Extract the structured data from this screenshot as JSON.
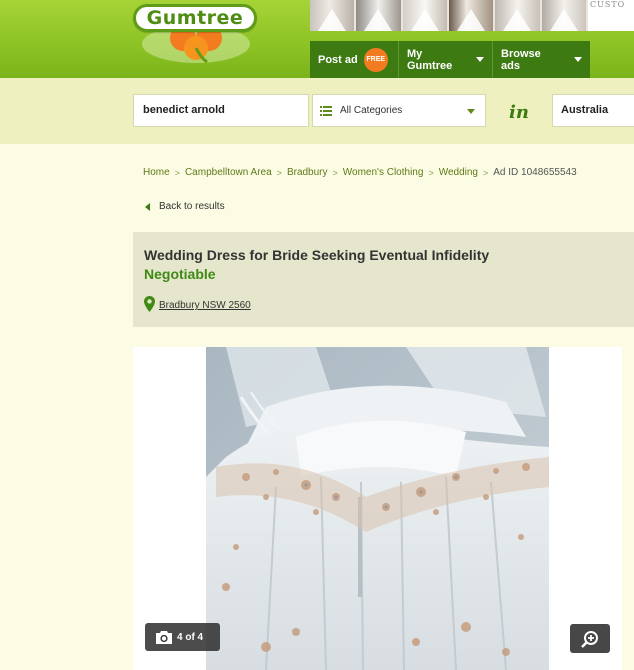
{
  "header": {
    "logo_text": "Gumtree",
    "banner_caption": "CUSTO",
    "nav": {
      "post_ad": "Post ad",
      "free_badge": "FREE",
      "my_gumtree": "My Gumtree",
      "browse_ads": "Browse ads"
    }
  },
  "search": {
    "query": "benedict arnold",
    "category": "All Categories",
    "in_label": "in",
    "location": "Australia"
  },
  "breadcrumb": [
    "Home",
    "Campbelltown Area",
    "Bradbury",
    "Women's Clothing",
    "Wedding"
  ],
  "breadcrumb_separator": ">",
  "ad_id": "Ad ID 1048655543",
  "back_link": "Back to results",
  "ad": {
    "title": "Wedding Dress for Bride Seeking Eventual Infidelity",
    "price": "Negotiable",
    "location": "Bradbury NSW 2560"
  },
  "gallery": {
    "photo_count": "4 of 4"
  },
  "colors": {
    "brand_green": "#3d7a12",
    "header_green": "#8cc224",
    "price_green": "#3f8a14",
    "free_orange": "#f47c20",
    "page_bg": "#fcfce4"
  },
  "icons": [
    "gumtree-clover-icon",
    "list-icon",
    "chevron-down-icon",
    "map-pin-icon",
    "camera-icon",
    "zoom-in-icon",
    "back-arrow-icon"
  ]
}
